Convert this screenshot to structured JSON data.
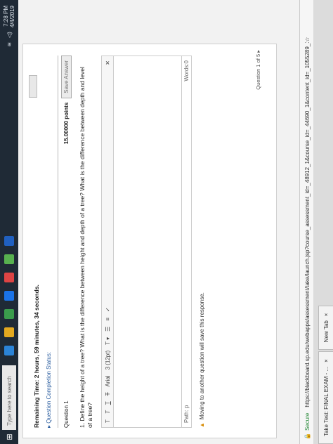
{
  "taskbar": {
    "search_placeholder": "Type here to search",
    "clock_time": "7:28 PM",
    "clock_date": "4/4/2019",
    "app_colors": [
      "#2b84d8",
      "#e3a920",
      "#3a9c4c",
      "#1a73e8",
      "#d44",
      "#57b14f",
      "#2060c0"
    ]
  },
  "browser": {
    "tab1_label": "Take Test: FINAL EXAM - ...",
    "tab2_label": "New Tab",
    "secure_label": "Secure",
    "url": "https://blackboard.sp.edu/webapps/assessment/take/launch.jsp?course_assessment_id=_48912_1&course_id=_44690_1&content_id=_1055289_1&step=..."
  },
  "test": {
    "timer": "Remaining Time: 2 hours, 59 minutes, 34 seconds.",
    "status_link": "Question Completion Status:",
    "question_label": "Question 1",
    "points": "15.00000 points",
    "save_answer": "Save Answer",
    "question_text": "1.  Define the height of a tree? What is the difference between height and depth of a tree? What is the difference between depth and level of a tree?",
    "font_family": "Arial",
    "font_size": "3 (12pt)",
    "path_label": "Path: p",
    "words_label": "Words:0",
    "moving_note": "Moving to another question will save this response.",
    "question_nav": "Question 1 of 5"
  }
}
